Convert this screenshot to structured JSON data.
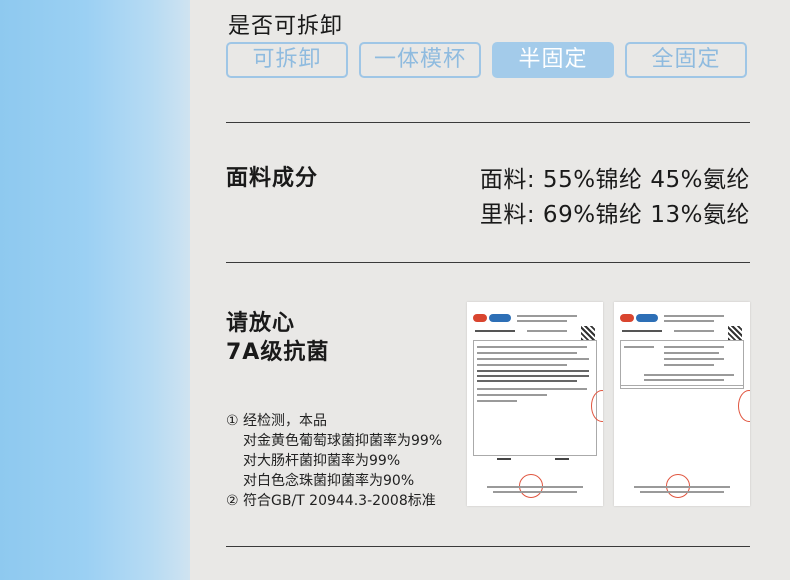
{
  "detachable": {
    "title": "是否可拆卸",
    "options": [
      "可拆卸",
      "一体模杯",
      "半固定",
      "全固定"
    ],
    "selected": "半固定"
  },
  "fabric": {
    "label": "面料成分",
    "lines": [
      "面料: 55%锦纶  45%氨纶",
      "里料: 69%锦纶  13%氨纶"
    ]
  },
  "antibacterial": {
    "title_line1": "请放心",
    "title_line2": "7A级抗菌",
    "notes": [
      "① 经检测，本品",
      "对金黄色葡萄球菌抑菌率为99%",
      "对大肠杆菌抑菌率为99%",
      "对白色念珠菌抑菌率为90%",
      "② 符合GB/T 20944.3-2008标准"
    ]
  },
  "colors": {
    "accent_blue": "#a3cbea",
    "option_text": "#8fbbdf",
    "left_strip": "#9bd0f3",
    "stamp_red": "#e0553f"
  },
  "icons": [
    "test-report-document-icon",
    "test-report-document-icon"
  ]
}
